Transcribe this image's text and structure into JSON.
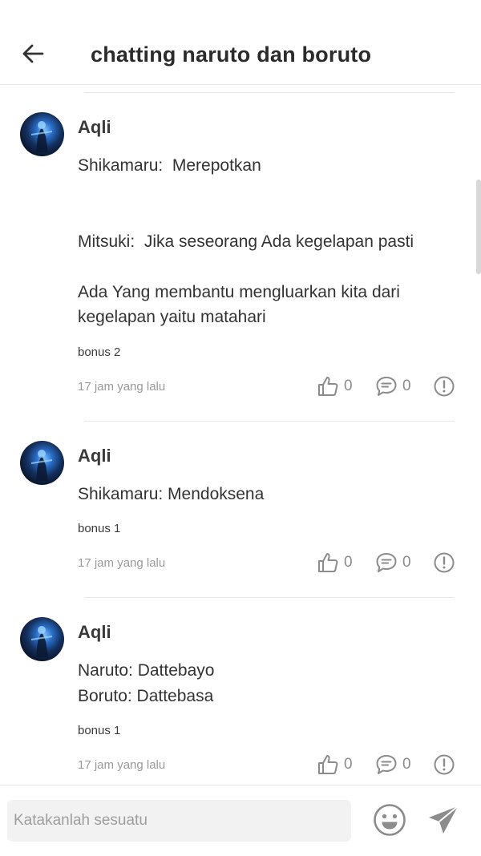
{
  "header": {
    "title": "chatting naruto dan boruto",
    "back_icon": "arrow-left-icon"
  },
  "posts": [
    {
      "author": "Aqli",
      "lines": [
        "Shikamaru:  Merepotkan",
        "",
        "",
        "Mitsuki:  Jika seseorang Ada kegelapan pasti",
        "",
        "Ada Yang membantu mengluarkan kita dari kegelapan yaitu matahari"
      ],
      "tag": "bonus 2",
      "time": "17 jam yang lalu",
      "likes": "0",
      "comments": "0"
    },
    {
      "author": "Aqli",
      "lines": [
        "Shikamaru: Mendoksena"
      ],
      "tag": "bonus 1",
      "time": "17 jam yang lalu",
      "likes": "0",
      "comments": "0"
    },
    {
      "author": "Aqli",
      "lines": [
        "Naruto: Dattebayo",
        "Boruto: Dattebasa"
      ],
      "tag": "bonus 1",
      "time": "17 jam yang lalu",
      "likes": "0",
      "comments": "0"
    }
  ],
  "composer": {
    "placeholder": "Katakanlah sesuatu",
    "emoji_icon": "smiley-icon",
    "send_icon": "send-icon"
  },
  "colors": {
    "text": "#333333",
    "muted": "#9a9a9a",
    "icon": "#8c8c8c",
    "divider": "#e8e8e8",
    "input_bg": "#f2f2f2"
  }
}
